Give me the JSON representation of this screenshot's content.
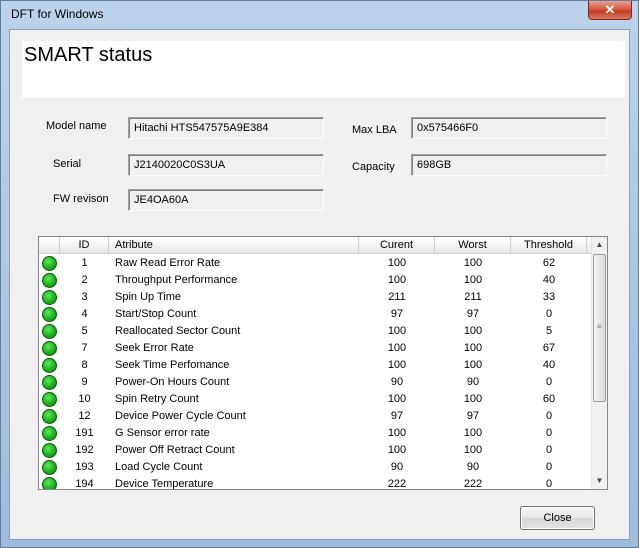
{
  "window": {
    "title": "DFT for Windows",
    "close_glyph": "✕"
  },
  "header": {
    "title": "SMART status"
  },
  "info": {
    "model_label": "Model name",
    "model_value": "Hitachi HTS547575A9E384",
    "serial_label": "Serial",
    "serial_value": "J2140020C0S3UA",
    "fw_label": "FW revison",
    "fw_value": "JE4OA60A",
    "maxlba_label": "Max LBA",
    "maxlba_value": "0x575466F0",
    "capacity_label": "Capacity",
    "capacity_value": "698GB"
  },
  "table": {
    "columns": [
      "",
      "ID",
      "Atribute",
      "Curent",
      "Worst",
      "Threshold"
    ],
    "rows": [
      {
        "status": "ok",
        "id": "1",
        "attr": "Raw Read Error Rate",
        "cur": "100",
        "worst": "100",
        "thr": "62"
      },
      {
        "status": "ok",
        "id": "2",
        "attr": "Throughput Performance",
        "cur": "100",
        "worst": "100",
        "thr": "40"
      },
      {
        "status": "ok",
        "id": "3",
        "attr": "Spin Up Time",
        "cur": "211",
        "worst": "211",
        "thr": "33"
      },
      {
        "status": "ok",
        "id": "4",
        "attr": "Start/Stop Count",
        "cur": "97",
        "worst": "97",
        "thr": "0"
      },
      {
        "status": "ok",
        "id": "5",
        "attr": "Reallocated Sector Count",
        "cur": "100",
        "worst": "100",
        "thr": "5"
      },
      {
        "status": "ok",
        "id": "7",
        "attr": "Seek Error Rate",
        "cur": "100",
        "worst": "100",
        "thr": "67"
      },
      {
        "status": "ok",
        "id": "8",
        "attr": "Seek Time Perfomance",
        "cur": "100",
        "worst": "100",
        "thr": "40"
      },
      {
        "status": "ok",
        "id": "9",
        "attr": "Power-On Hours Count",
        "cur": "90",
        "worst": "90",
        "thr": "0"
      },
      {
        "status": "ok",
        "id": "10",
        "attr": "Spin Retry Count",
        "cur": "100",
        "worst": "100",
        "thr": "60"
      },
      {
        "status": "ok",
        "id": "12",
        "attr": "Device Power Cycle Count",
        "cur": "97",
        "worst": "97",
        "thr": "0"
      },
      {
        "status": "ok",
        "id": "191",
        "attr": "G Sensor error rate",
        "cur": "100",
        "worst": "100",
        "thr": "0"
      },
      {
        "status": "ok",
        "id": "192",
        "attr": "Power Off Retract Count",
        "cur": "100",
        "worst": "100",
        "thr": "0"
      },
      {
        "status": "ok",
        "id": "193",
        "attr": "Load Cycle Count",
        "cur": "90",
        "worst": "90",
        "thr": "0"
      },
      {
        "status": "ok",
        "id": "194",
        "attr": "Device Temperature",
        "cur": "222",
        "worst": "222",
        "thr": "0"
      }
    ]
  },
  "scrollbar": {
    "up": "▲",
    "down": "▼",
    "grip": "≡"
  },
  "buttons": {
    "close_label": "Close"
  },
  "colors": {
    "status_ok": "#1db01d"
  }
}
